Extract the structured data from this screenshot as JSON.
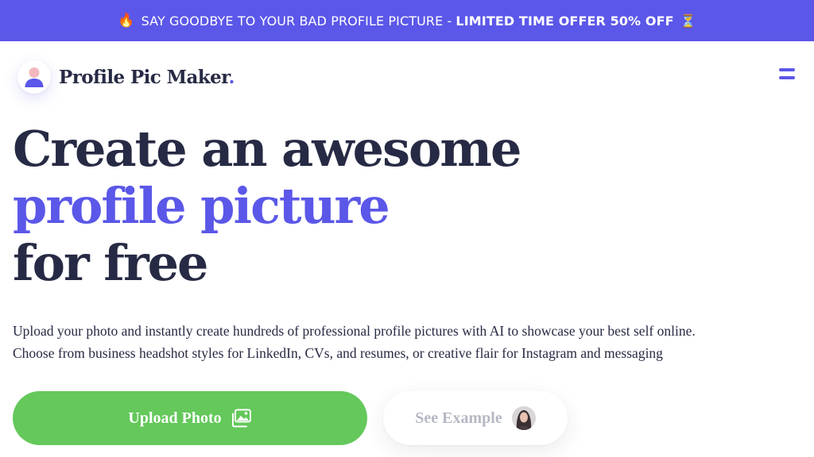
{
  "banner": {
    "leading_emoji": "🔥",
    "text": "SAY GOODBYE TO YOUR BAD PROFILE PICTURE -",
    "offer": "LIMITED TIME OFFER 50% OFF",
    "trailing_emoji": "⏳"
  },
  "header": {
    "logo_text": "Profile Pic Maker",
    "logo_dot": ".",
    "logo_icon": "person-avatar-icon",
    "menu_icon": "hamburger-menu-icon"
  },
  "hero": {
    "headline_line1": "Create an awesome",
    "headline_line2": "profile picture",
    "headline_line3": "for free",
    "description_line1": "Upload your photo and instantly create hundreds of professional profile pictures with AI to showcase your best self online.",
    "description_line2": "Choose from business headshot styles for LinkedIn, CVs, and resumes, or creative flair for Instagram and messaging"
  },
  "actions": {
    "upload_label": "Upload Photo",
    "upload_icon": "image-upload-icon",
    "example_label": "See Example",
    "example_avatar": "example-portrait-avatar"
  },
  "colors": {
    "accent": "#5b57e8",
    "primary_text": "#272a44",
    "upload_green": "#64c85b",
    "muted": "#b5b7c3"
  }
}
